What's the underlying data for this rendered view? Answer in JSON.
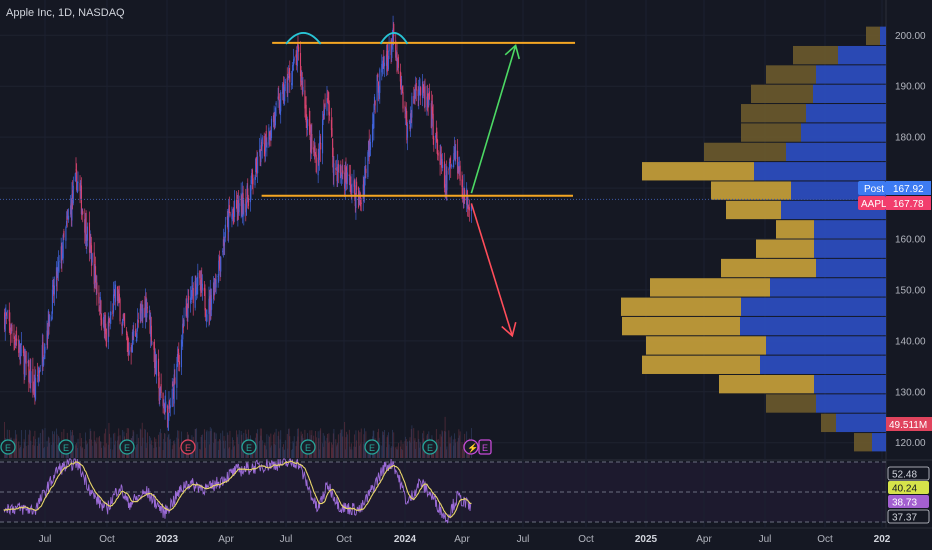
{
  "header": {
    "title": "Apple Inc, 1D, NASDAQ"
  },
  "colors": {
    "background": "#151823",
    "up": "#3f62d9",
    "down": "#d9436e",
    "level_line": "#f5a623",
    "arc": "#29c5d6",
    "arrow_up": "#4cd964",
    "arrow_down": "#ff4d5a",
    "vp_buy": "#2c4fc4",
    "vp_sell": "#c9a23a",
    "rsi_line": "#9b6bd6",
    "rsi_ma": "#e8d66a",
    "current_price": "#f23d6d",
    "post_price": "#3d7bf2"
  },
  "chart_data": [
    {
      "type": "candlestick",
      "x_ticks": [
        "Jul",
        "Oct",
        "2023",
        "Apr",
        "Jul",
        "Oct",
        "2024",
        "Apr",
        "Jul",
        "Oct",
        "2025",
        "Apr",
        "Jul",
        "Oct",
        "202"
      ],
      "y_ticks": [
        120,
        130,
        140,
        150,
        160,
        170,
        180,
        190,
        200
      ],
      "ylim": [
        117,
        203
      ],
      "price_path": [
        [
          "2022-05-01",
          145
        ],
        [
          "2022-05-20",
          140
        ],
        [
          "2022-06-16",
          130
        ],
        [
          "2022-07-15",
          150
        ],
        [
          "2022-08-17",
          172
        ],
        [
          "2022-09-10",
          155
        ],
        [
          "2022-09-30",
          140
        ],
        [
          "2022-10-15",
          150
        ],
        [
          "2022-11-03",
          138
        ],
        [
          "2022-12-01",
          148
        ],
        [
          "2022-12-20",
          130
        ],
        [
          "2023-01-03",
          125
        ],
        [
          "2023-01-30",
          145
        ],
        [
          "2023-02-15",
          152
        ],
        [
          "2023-03-05",
          146
        ],
        [
          "2023-04-05",
          164
        ],
        [
          "2023-05-03",
          168
        ],
        [
          "2023-06-01",
          180
        ],
        [
          "2023-06-20",
          186
        ],
        [
          "2023-07-20",
          196
        ],
        [
          "2023-08-10",
          178
        ],
        [
          "2023-08-20",
          175
        ],
        [
          "2023-09-05",
          189
        ],
        [
          "2023-09-15",
          174
        ],
        [
          "2023-10-05",
          172
        ],
        [
          "2023-10-26",
          167
        ],
        [
          "2023-11-20",
          190
        ],
        [
          "2023-12-14",
          199
        ],
        [
          "2024-01-05",
          181
        ],
        [
          "2024-01-20",
          191
        ],
        [
          "2024-02-10",
          185
        ],
        [
          "2024-03-05",
          170
        ],
        [
          "2024-03-20",
          178
        ],
        [
          "2024-04-05",
          168
        ],
        [
          "2024-04-15",
          167.78
        ]
      ],
      "volume_events": [
        "E",
        "E",
        "E",
        "E",
        "E",
        "E",
        "E",
        "E",
        "E"
      ],
      "volume_last_event": "E",
      "resistance_level": 198.5,
      "support_level": 168.5,
      "projection_up": {
        "from": [
          "2024-04-15",
          169
        ],
        "to": [
          "2024-06-20",
          198
        ]
      },
      "projection_down": {
        "from": [
          "2024-04-15",
          167
        ],
        "to": [
          "2024-06-15",
          141
        ]
      },
      "volume_profile": {
        "bin_size": 3.8,
        "bins": [
          {
            "price": 199.8,
            "buy": 6,
            "sell": 14
          },
          {
            "price": 196.0,
            "buy": 48,
            "sell": 45
          },
          {
            "price": 192.2,
            "buy": 70,
            "sell": 50
          },
          {
            "price": 188.4,
            "buy": 73,
            "sell": 62
          },
          {
            "price": 184.6,
            "buy": 80,
            "sell": 65
          },
          {
            "price": 180.8,
            "buy": 85,
            "sell": 60
          },
          {
            "price": 177.0,
            "buy": 100,
            "sell": 82
          },
          {
            "price": 173.2,
            "buy": 132,
            "sell": 112
          },
          {
            "price": 169.4,
            "buy": 95,
            "sell": 80
          },
          {
            "price": 165.6,
            "buy": 105,
            "sell": 55
          },
          {
            "price": 161.8,
            "buy": 72,
            "sell": 38
          },
          {
            "price": 158.0,
            "buy": 72,
            "sell": 58
          },
          {
            "price": 154.2,
            "buy": 70,
            "sell": 95
          },
          {
            "price": 150.4,
            "buy": 116,
            "sell": 120
          },
          {
            "price": 146.6,
            "buy": 145,
            "sell": 120
          },
          {
            "price": 142.8,
            "buy": 146,
            "sell": 118
          },
          {
            "price": 139.0,
            "buy": 120,
            "sell": 120
          },
          {
            "price": 135.2,
            "buy": 126,
            "sell": 118
          },
          {
            "price": 131.4,
            "buy": 72,
            "sell": 95
          },
          {
            "price": 127.6,
            "buy": 70,
            "sell": 50
          },
          {
            "price": 123.8,
            "buy": 50,
            "sell": 15
          },
          {
            "price": 120.0,
            "buy": 14,
            "sell": 18
          }
        ]
      },
      "labels": {
        "post": "Post",
        "post_value": "167.92",
        "ticker": "AAPL",
        "last_value": "167.78",
        "volume": "49.511M"
      }
    },
    {
      "type": "line",
      "name": "RSI",
      "ylim": [
        30,
        70
      ],
      "levels": [
        70,
        50,
        30
      ],
      "path": [
        [
          "2022-05-01",
          40
        ],
        [
          "2022-06-16",
          38
        ],
        [
          "2022-07-20",
          65
        ],
        [
          "2022-08-17",
          70
        ],
        [
          "2022-09-10",
          48
        ],
        [
          "2022-09-30",
          38
        ],
        [
          "2022-10-20",
          54
        ],
        [
          "2022-11-03",
          42
        ],
        [
          "2022-12-01",
          50
        ],
        [
          "2022-12-28",
          36
        ],
        [
          "2023-01-30",
          56
        ],
        [
          "2023-03-05",
          52
        ],
        [
          "2023-04-15",
          64
        ],
        [
          "2023-06-01",
          68
        ],
        [
          "2023-07-20",
          70
        ],
        [
          "2023-08-20",
          38
        ],
        [
          "2023-09-05",
          55
        ],
        [
          "2023-09-25",
          40
        ],
        [
          "2023-10-26",
          38
        ],
        [
          "2023-11-30",
          66
        ],
        [
          "2023-12-14",
          70
        ],
        [
          "2024-01-05",
          42
        ],
        [
          "2024-01-25",
          57
        ],
        [
          "2024-02-15",
          46
        ],
        [
          "2024-03-07",
          32
        ],
        [
          "2024-03-25",
          47
        ],
        [
          "2024-04-15",
          39
        ]
      ],
      "value_labels": [
        "52.48",
        "40.24",
        "38.73",
        "37.37"
      ]
    }
  ]
}
